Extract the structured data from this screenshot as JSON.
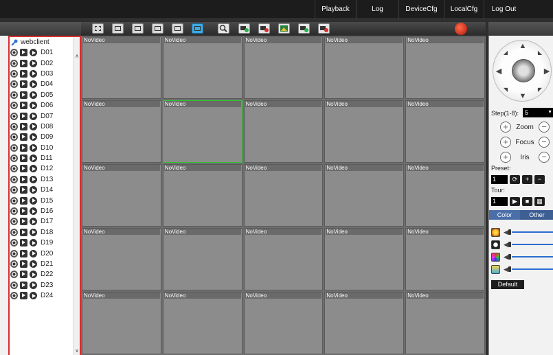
{
  "nav": {
    "items": [
      {
        "label": "Playback"
      },
      {
        "label": "Log"
      },
      {
        "label": "DeviceCfg"
      },
      {
        "label": "LocalCfg"
      },
      {
        "label": "Log Out"
      }
    ]
  },
  "tree": {
    "root_label": "webclient",
    "channels": [
      "D01",
      "D02",
      "D03",
      "D04",
      "D05",
      "D06",
      "D07",
      "D08",
      "D09",
      "D10",
      "D11",
      "D12",
      "D13",
      "D14",
      "D15",
      "D16",
      "D17",
      "D18",
      "D19",
      "D20",
      "D21",
      "D22",
      "D23",
      "D24"
    ]
  },
  "video": {
    "cell_label": "NoVideo",
    "rows": 5,
    "cols": 5,
    "selected_cell": 6
  },
  "ptz": {
    "step_label": "Step(1-8):",
    "step_value": "5",
    "zoom_label": "Zoom",
    "focus_label": "Focus",
    "iris_label": "Iris",
    "preset_label": "Preset:",
    "preset_value": "1",
    "tour_label": "Tour:",
    "tour_value": "1"
  },
  "tabs": {
    "color": "Color",
    "other": "Other"
  },
  "image_settings": {
    "default_label": "Default"
  },
  "colors": {
    "accent_active": "#3fa9e0",
    "selected_border": "#2bc82b",
    "panel_border": "#d62f2f"
  }
}
